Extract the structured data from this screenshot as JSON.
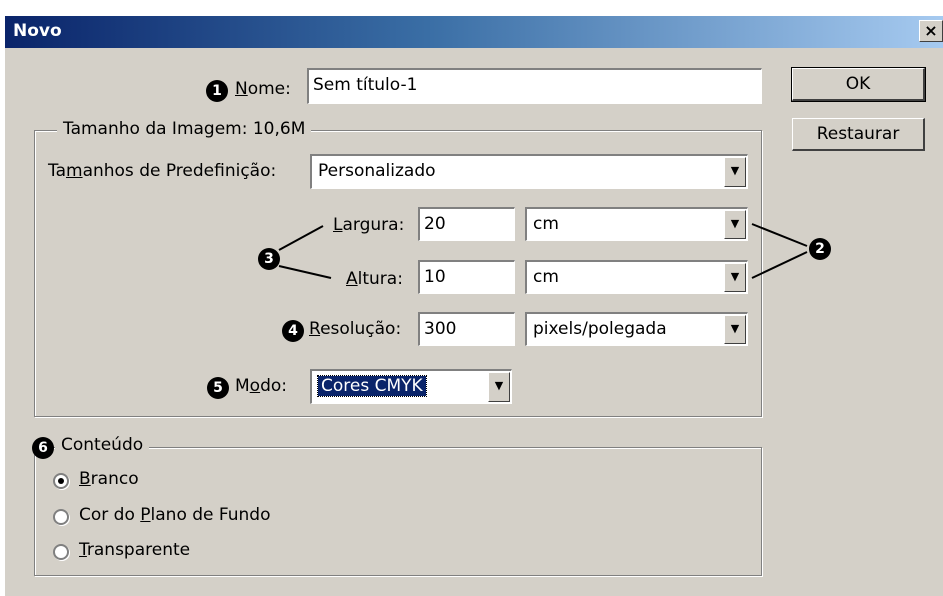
{
  "dialog": {
    "title": "Novo",
    "close_glyph": "×"
  },
  "callouts": [
    "1",
    "2",
    "3",
    "4",
    "5",
    "6"
  ],
  "name": {
    "label": "Nome:",
    "mnemonic": "N",
    "label_rest": "ome:",
    "value": "Sem título-1"
  },
  "buttons": {
    "ok": "OK",
    "restore": "Restaurar"
  },
  "image_size": {
    "legend": "Tamanho da Imagem: 10,6M",
    "preset_label_a": "Ta",
    "preset_mnemonic": "m",
    "preset_label_b": "anhos de Predefinição:",
    "preset_value": "Personalizado",
    "width_label_mnemonic": "L",
    "width_label_rest": "argura:",
    "width_value": "20",
    "width_unit": "cm",
    "height_label_mnemonic": "A",
    "height_label_rest": "ltura:",
    "height_value": "10",
    "height_unit": "cm",
    "resolution_label_mnemonic": "R",
    "resolution_label_rest": "esolução:",
    "resolution_value": "300",
    "resolution_unit": "pixels/polegada",
    "mode_label_a": "M",
    "mode_mnemonic": "o",
    "mode_label_b": "do:",
    "mode_value": "Cores CMYK"
  },
  "contents": {
    "legend": "Conteúdo",
    "options": [
      {
        "mnemonic": "B",
        "rest": "ranco",
        "pre": "",
        "checked": true
      },
      {
        "pre": "Cor do ",
        "mnemonic": "P",
        "rest": "lano de Fundo",
        "checked": false
      },
      {
        "mnemonic": "T",
        "rest": "ransparente",
        "pre": "",
        "checked": false
      }
    ]
  },
  "arrow_glyph": "▼"
}
